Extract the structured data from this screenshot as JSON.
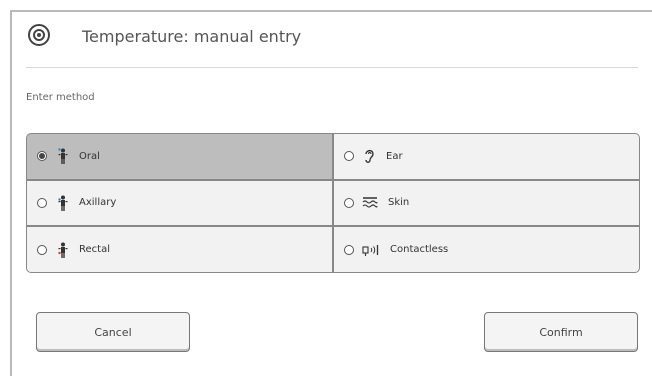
{
  "header": {
    "title": "Temperature: manual entry",
    "icon": "target-icon"
  },
  "method": {
    "label": "Enter method",
    "selected": "Oral",
    "options": [
      {
        "label": "Oral",
        "icon": "person-oral-icon",
        "selected": true
      },
      {
        "label": "Ear",
        "icon": "ear-icon",
        "selected": false
      },
      {
        "label": "Axillary",
        "icon": "person-axillary-icon",
        "selected": false
      },
      {
        "label": "Skin",
        "icon": "skin-icon",
        "selected": false
      },
      {
        "label": "Rectal",
        "icon": "person-rectal-icon",
        "selected": false
      },
      {
        "label": "Contactless",
        "icon": "contactless-icon",
        "selected": false
      }
    ]
  },
  "buttons": {
    "cancel": "Cancel",
    "confirm": "Confirm"
  },
  "colors": {
    "selected_bg": "#bdbdbd",
    "option_bg": "#f2f2f2",
    "border": "#888888",
    "oral_marker": "#1e88e5",
    "axillary_marker": "#1e88e5",
    "rectal_marker": "#e53935"
  }
}
